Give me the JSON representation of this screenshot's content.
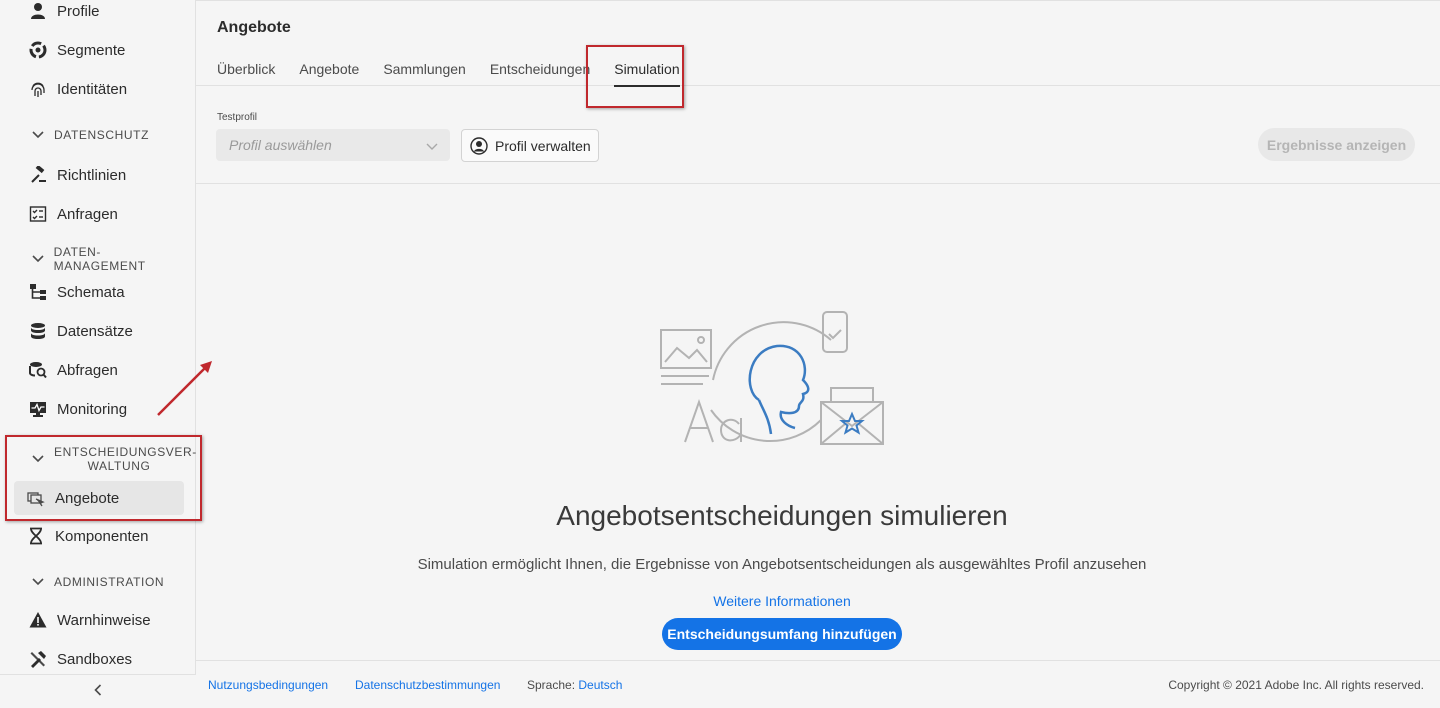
{
  "sidebar": {
    "items_top": [
      {
        "label": "Profile",
        "icon": "profile-icon"
      },
      {
        "label": "Segmente",
        "icon": "segments-icon"
      },
      {
        "label": "Identitäten",
        "icon": "fingerprint-icon"
      }
    ],
    "section_privacy": "DATENSCHUTZ",
    "privacy_items": [
      {
        "label": "Richtlinien",
        "icon": "gavel-icon"
      },
      {
        "label": "Anfragen",
        "icon": "checklist-icon"
      }
    ],
    "section_data": "DATEN-MANAGEMENT",
    "data_items": [
      {
        "label": "Schemata",
        "icon": "schema-icon"
      },
      {
        "label": "Datensätze",
        "icon": "database-icon"
      },
      {
        "label": "Abfragen",
        "icon": "query-icon"
      },
      {
        "label": "Monitoring",
        "icon": "monitor-icon"
      }
    ],
    "section_decision": "ENTSCHEIDUNGSVER-WALTUNG",
    "section_decision_line1": "ENTSCHEIDUNGSVER-",
    "section_decision_line2": "WALTUNG",
    "decision_items": [
      {
        "label": "Angebote",
        "icon": "offers-icon",
        "active": true
      },
      {
        "label": "Komponenten",
        "icon": "components-icon"
      }
    ],
    "section_admin": "ADMINISTRATION",
    "admin_items": [
      {
        "label": "Warnhinweise",
        "icon": "alert-icon"
      },
      {
        "label": "Sandboxes",
        "icon": "tools-icon"
      }
    ]
  },
  "header": {
    "title": "Angebote",
    "tabs": [
      {
        "label": "Überblick"
      },
      {
        "label": "Angebote"
      },
      {
        "label": "Sammlungen"
      },
      {
        "label": "Entscheidungen"
      },
      {
        "label": "Simulation",
        "active": true
      }
    ]
  },
  "toolbar": {
    "field_label": "Testprofil",
    "picker_placeholder": "Profil auswählen",
    "manage_label": "Profil verwalten",
    "results_label": "Ergebnisse anzeigen"
  },
  "empty_state": {
    "title": "Angebotsentscheidungen simulieren",
    "description": "Simulation ermöglicht Ihnen, die Ergebnisse von Angebotsentscheidungen als ausgewähltes Profil anzusehen",
    "link": "Weitere Informationen",
    "button": "Entscheidungsumfang hinzufügen"
  },
  "footer": {
    "terms": "Nutzungsbedingungen",
    "privacy": "Datenschutzbestimmungen",
    "language_label": "Sprache:",
    "language_value": "Deutsch",
    "copyright": "Copyright © 2021 Adobe Inc. All rights reserved."
  },
  "colors": {
    "accent": "#1473e6",
    "annotation_red": "#c0282d"
  }
}
